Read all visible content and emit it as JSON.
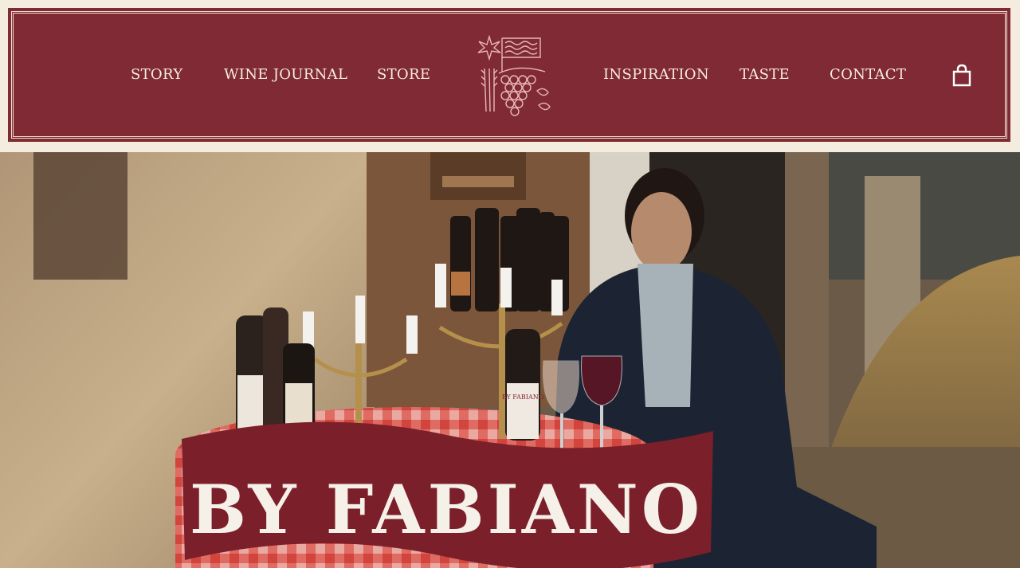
{
  "nav": {
    "left": [
      "STORY",
      "WINE JOURNAL",
      "STORE"
    ],
    "right": [
      "INSPIRATION",
      "TASTE",
      "CONTACT"
    ]
  },
  "header": {
    "logo_icon": "grape-sunburst-logo-icon",
    "cart_icon": "shopping-bag-icon"
  },
  "hero": {
    "banner_text": "BY FABIANO",
    "bottle_label": "BY FABIANO"
  },
  "colors": {
    "brand_red": "#7f2a35",
    "cream": "#f3ecdf",
    "banner_red": "#7b1f2a"
  }
}
